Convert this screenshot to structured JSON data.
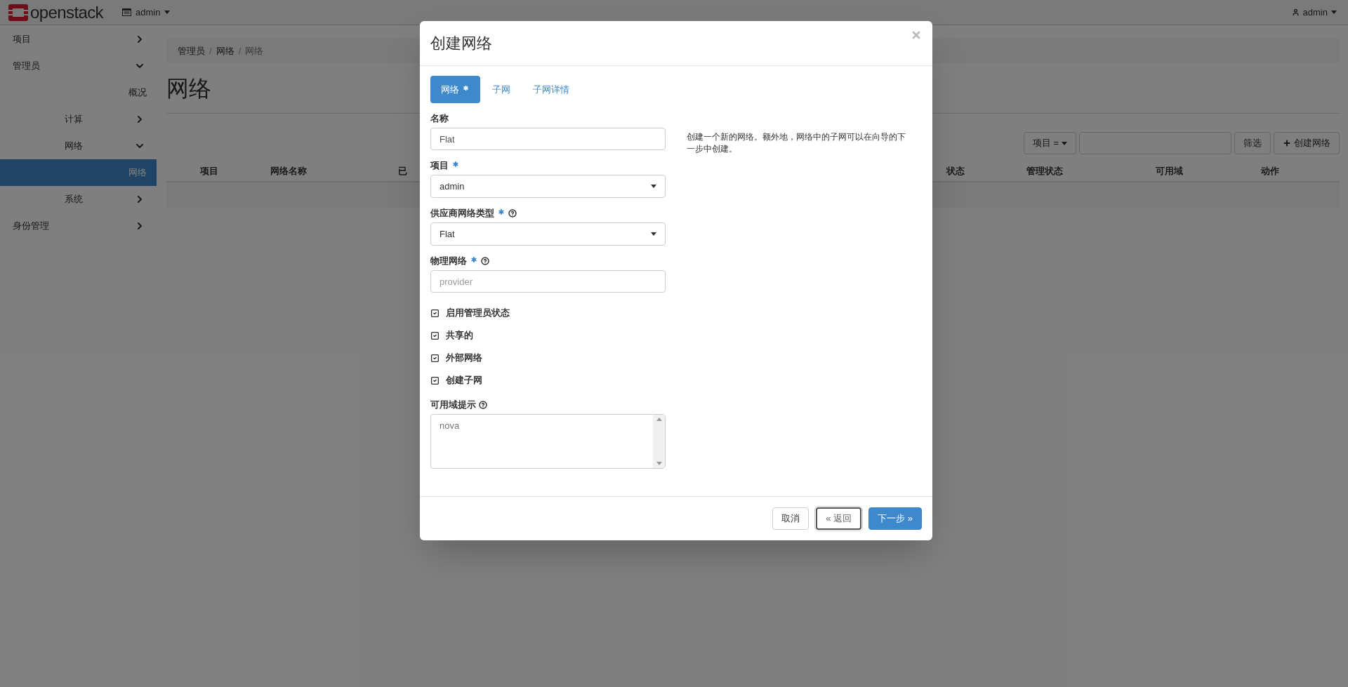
{
  "header": {
    "logo": "openstack",
    "project_menu": "admin",
    "user_menu": "admin"
  },
  "sidebar": {
    "items": [
      {
        "label": "项目",
        "expanded": false,
        "selected": false
      },
      {
        "label": "管理员",
        "expanded": true,
        "selected": false,
        "children": [
          {
            "label": "概况",
            "selected": false
          },
          {
            "label": "计算",
            "expanded": false,
            "selected": false
          },
          {
            "label": "网络",
            "expanded": true,
            "selected": false,
            "children": [
              {
                "label": "网络",
                "selected": true
              }
            ]
          },
          {
            "label": "系统",
            "expanded": false,
            "selected": false
          }
        ]
      },
      {
        "label": "身份管理",
        "expanded": false,
        "selected": false
      }
    ]
  },
  "breadcrumb": {
    "separator": "/",
    "items": [
      "管理员",
      "网络",
      "网络"
    ]
  },
  "page_title": "网络",
  "toolbar": {
    "filter_field": "项目 =",
    "filter_button": "筛选",
    "create_button": "创建网络"
  },
  "table": {
    "columns": [
      "项目",
      "网络名称",
      "已",
      "状态",
      "管理状态",
      "可用域",
      "动作"
    ]
  },
  "modal": {
    "title": "创建网络",
    "tabs": [
      {
        "label": "网络",
        "required": true,
        "selected": true
      },
      {
        "label": "子网",
        "required": false,
        "selected": false
      },
      {
        "label": "子网详情",
        "required": false,
        "selected": false
      }
    ],
    "fields": [
      {
        "kind": "text",
        "label": "名称",
        "required": false,
        "help": false,
        "value": "Flat"
      },
      {
        "kind": "select",
        "label": "项目",
        "required": true,
        "help": false,
        "value": "admin"
      },
      {
        "kind": "select",
        "label": "供应商网络类型",
        "required": true,
        "help": true,
        "value": "Flat"
      },
      {
        "kind": "text",
        "label": "物理网络",
        "required": true,
        "help": true,
        "placeholder": "provider"
      },
      {
        "kind": "checkbox",
        "label": "启用管理员状态",
        "checked": true
      },
      {
        "kind": "checkbox",
        "label": "共享的",
        "checked": true
      },
      {
        "kind": "checkbox",
        "label": "外部网络",
        "checked": true
      },
      {
        "kind": "checkbox",
        "label": "创建子网",
        "checked": true
      },
      {
        "kind": "listbox",
        "label": "可用域提示",
        "required": false,
        "help": true,
        "options": [
          "nova"
        ]
      }
    ],
    "description": "创建一个新的网络。额外地，网络中的子网可以在向导的下一步中创建。",
    "buttons": [
      {
        "kind": "default",
        "label": "取消"
      },
      {
        "kind": "back",
        "label": "« 返回"
      },
      {
        "kind": "primary",
        "label": "下一步 »"
      }
    ]
  }
}
